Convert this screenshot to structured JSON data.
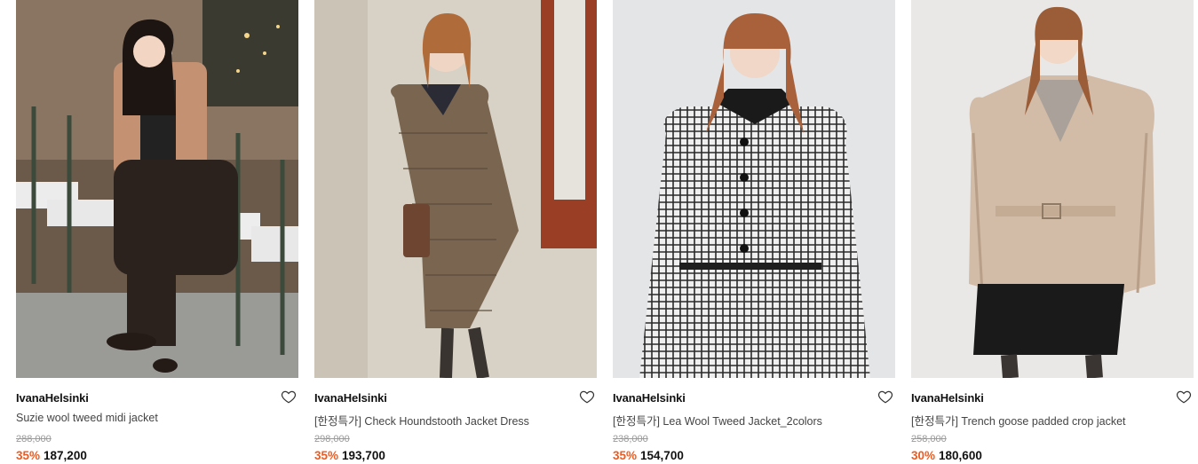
{
  "products": [
    {
      "brand": "IvanaHelsinki",
      "name": "Suzie wool tweed midi jacket",
      "original_price": "288,000",
      "discount": "35%",
      "sale_price": "187,200",
      "wishlist_icon": "heart-outline-icon"
    },
    {
      "brand": "IvanaHelsinki",
      "name": "[한정특가] Check Houndstooth Jacket Dress",
      "original_price": "298,000",
      "discount": "35%",
      "sale_price": "193,700",
      "wishlist_icon": "heart-outline-icon"
    },
    {
      "brand": "IvanaHelsinki",
      "name": "[한정특가] Lea Wool Tweed Jacket_2colors",
      "original_price": "238,000",
      "discount": "35%",
      "sale_price": "154,700",
      "wishlist_icon": "heart-outline-icon"
    },
    {
      "brand": "IvanaHelsinki",
      "name": "[한정특가] Trench goose padded crop jacket",
      "original_price": "258,000",
      "discount": "30%",
      "sale_price": "180,600",
      "wishlist_icon": "heart-outline-icon"
    }
  ],
  "colors": {
    "discount": "#ef5a1d",
    "original_price": "#9a9a9a",
    "text": "#111111"
  }
}
